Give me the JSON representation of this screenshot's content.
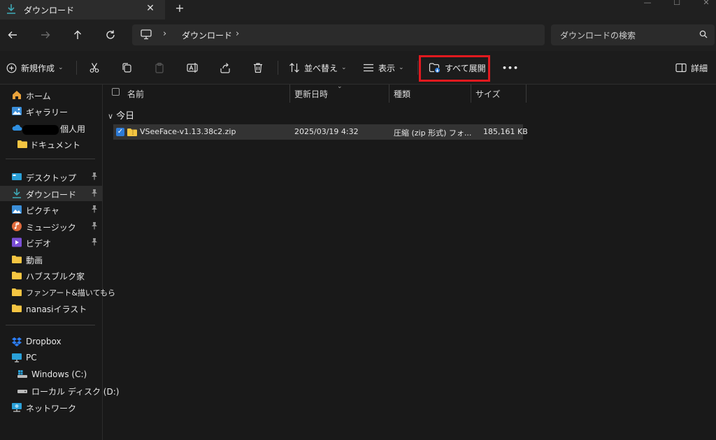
{
  "tab": {
    "title": "ダウンロード",
    "close": "✕",
    "new_tab": "+"
  },
  "window_controls": {
    "minimize": "—",
    "maximize": "☐",
    "close": "✕"
  },
  "address": {
    "crumb": "ダウンロード",
    "sep": "›"
  },
  "search": {
    "placeholder": "ダウンロードの検索"
  },
  "toolbar": {
    "new_label": "新規作成",
    "sort_label": "並べ替え",
    "view_label": "表示",
    "extract_all_label": "すべて展開",
    "more_label": "•••",
    "details_label": "詳細",
    "chevron": "⌄"
  },
  "sidebar": {
    "home": "ホーム",
    "gallery": "ギャラリー",
    "personal": "個人用",
    "documents": "ドキュメント",
    "desktop": "デスクトップ",
    "downloads": "ダウンロード",
    "pictures": "ピクチャ",
    "music": "ミュージック",
    "videos": "ビデオ",
    "folder1": "動画",
    "folder2": "ハブスブルク家",
    "folder3": "ファンアート&描いてもら",
    "folder4": "nanasiイラスト",
    "dropbox": "Dropbox",
    "pc": "PC",
    "drive_c": "Windows (C:)",
    "drive_d": "ローカル ディスク (D:)",
    "network": "ネットワーク"
  },
  "columns": {
    "name": "名前",
    "modified": "更新日時",
    "type": "種類",
    "size": "サイズ"
  },
  "group": {
    "label": "今日",
    "chevron": "∨"
  },
  "files": [
    {
      "name": "VSeeFace-v1.13.38c2.zip",
      "modified": "2025/03/19 4:32",
      "type": "圧縮 (zip 形式) フォ...",
      "size": "185,161 KB",
      "selected": true
    }
  ],
  "colors": {
    "accent": "#2e7bd6",
    "highlight_box": "#e1191f",
    "folder": "#f4c542",
    "download": "#3ea6b3"
  }
}
